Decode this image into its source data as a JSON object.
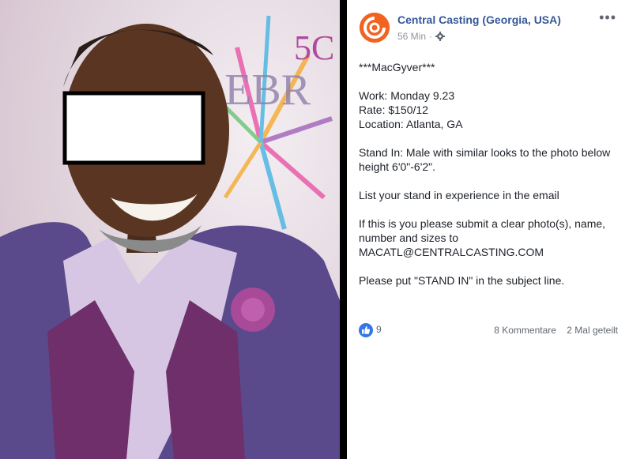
{
  "post": {
    "page_name": "Central Casting (Georgia, USA)",
    "time": "56 Min",
    "privacy_icon": "gear-icon",
    "more_icon": "ellipsis-icon",
    "paragraphs": [
      "***MacGyver***",
      "Work: Monday 9.23\nRate: $150/12\nLocation: Atlanta, GA",
      "Stand In: Male with similar looks to the photo below height 6'0\"-6'2\".",
      "List your stand in experience in the email",
      "If this is you please submit a clear photo(s), name, number and sizes to\nMACATL@CENTRALCASTING.COM",
      "Please put \"STAND IN\" in the subject line."
    ],
    "likes": "9",
    "comments": "8 Kommentare",
    "shares": "2 Mal geteilt"
  },
  "photo": {
    "background_text_big": "5C",
    "background_text_line": "LEBR"
  },
  "colors": {
    "link": "#365899",
    "like": "#3578e5",
    "brand": "#f26322"
  }
}
